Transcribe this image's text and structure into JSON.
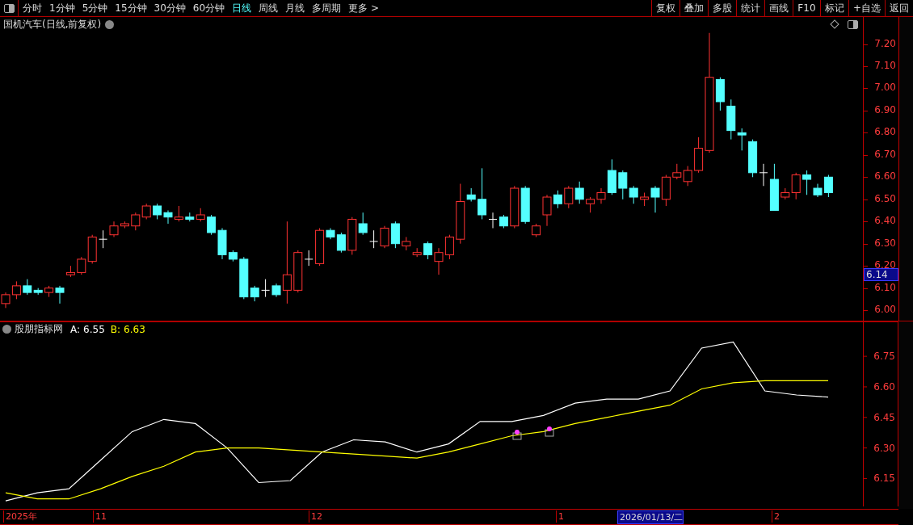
{
  "toolbar": {
    "periods": [
      {
        "label": "分时",
        "selected": false
      },
      {
        "label": "1分钟",
        "selected": false
      },
      {
        "label": "5分钟",
        "selected": false
      },
      {
        "label": "15分钟",
        "selected": false
      },
      {
        "label": "30分钟",
        "selected": false
      },
      {
        "label": "60分钟",
        "selected": false
      },
      {
        "label": "日线",
        "selected": true
      },
      {
        "label": "周线",
        "selected": false
      },
      {
        "label": "月线",
        "selected": false
      },
      {
        "label": "多周期",
        "selected": false
      }
    ],
    "more": "更多 >",
    "buttons": [
      "复权",
      "叠加",
      "多股",
      "统计",
      "画线",
      "F10",
      "标记",
      "+自选",
      "返回"
    ]
  },
  "price_chart": {
    "title": "国机汽车(日线,前复权)",
    "current_price": "6.14",
    "chart_data": {
      "type": "candlestick",
      "categories": [
        null,
        null,
        null,
        null,
        null,
        null,
        null,
        null,
        null,
        null,
        null,
        null,
        null,
        null,
        null,
        null,
        null,
        null,
        null,
        null,
        null,
        null,
        null,
        null,
        null,
        null,
        null,
        null,
        null,
        null,
        null,
        null,
        null,
        null,
        null,
        null,
        null,
        null,
        null,
        null,
        null,
        null,
        null,
        null,
        null,
        null,
        null,
        null,
        null,
        null,
        null,
        null,
        null,
        null,
        null,
        null,
        null,
        null,
        null,
        null,
        null,
        null,
        null,
        null,
        null,
        null,
        null,
        null,
        null,
        null,
        null,
        null,
        null,
        null,
        null,
        null,
        null
      ],
      "ylim": [
        5.953,
        7.322
      ],
      "yticks": [
        {
          "value": 7.2,
          "label": "7.20"
        },
        {
          "value": 7.1,
          "label": "7.10"
        },
        {
          "value": 7.0,
          "label": "7.00"
        },
        {
          "value": 6.9,
          "label": "6.90"
        },
        {
          "value": 6.8,
          "label": "6.80"
        },
        {
          "value": 6.7,
          "label": "6.70"
        },
        {
          "value": 6.6,
          "label": "6.60"
        },
        {
          "value": 6.5,
          "label": "6.50"
        },
        {
          "value": 6.4,
          "label": "6.40"
        },
        {
          "value": 6.3,
          "label": "6.30"
        },
        {
          "value": 6.2,
          "label": "6.20"
        },
        {
          "value": 6.1,
          "label": "6.10"
        },
        {
          "value": 6.0,
          "label": "6.00"
        }
      ],
      "ohlc": [
        [
          6.03,
          6.08,
          6.01,
          6.07
        ],
        [
          6.07,
          6.13,
          6.05,
          6.11
        ],
        [
          6.11,
          6.14,
          6.07,
          6.08
        ],
        [
          6.09,
          6.1,
          6.07,
          6.08
        ],
        [
          6.08,
          6.11,
          6.06,
          6.1
        ],
        [
          6.1,
          6.11,
          6.03,
          6.08
        ],
        [
          6.16,
          6.2,
          6.15,
          6.17
        ],
        [
          6.17,
          6.24,
          6.16,
          6.23
        ],
        [
          6.22,
          6.34,
          6.21,
          6.33
        ],
        [
          6.32,
          6.36,
          6.28,
          6.32
        ],
        [
          6.34,
          6.4,
          6.33,
          6.38
        ],
        [
          6.38,
          6.4,
          6.37,
          6.39
        ],
        [
          6.38,
          6.44,
          6.36,
          6.43
        ],
        [
          6.42,
          6.48,
          6.41,
          6.47
        ],
        [
          6.47,
          6.48,
          6.41,
          6.43
        ],
        [
          6.44,
          6.45,
          6.39,
          6.42
        ],
        [
          6.41,
          6.47,
          6.4,
          6.42
        ],
        [
          6.42,
          6.44,
          6.4,
          6.41
        ],
        [
          6.41,
          6.46,
          6.4,
          6.43
        ],
        [
          6.42,
          6.43,
          6.34,
          6.35
        ],
        [
          6.36,
          6.37,
          6.23,
          6.25
        ],
        [
          6.26,
          6.27,
          6.22,
          6.23
        ],
        [
          6.23,
          6.24,
          6.05,
          6.06
        ],
        [
          6.1,
          6.11,
          6.04,
          6.06
        ],
        [
          6.09,
          6.14,
          6.06,
          6.09
        ],
        [
          6.11,
          6.12,
          6.06,
          6.07
        ],
        [
          6.09,
          6.4,
          6.03,
          6.16
        ],
        [
          6.09,
          6.27,
          6.08,
          6.26
        ],
        [
          6.23,
          6.27,
          6.2,
          6.23
        ],
        [
          6.21,
          6.37,
          6.2,
          6.36
        ],
        [
          6.36,
          6.37,
          6.32,
          6.33
        ],
        [
          6.34,
          6.35,
          6.26,
          6.27
        ],
        [
          6.27,
          6.42,
          6.25,
          6.41
        ],
        [
          6.39,
          6.44,
          6.34,
          6.35
        ],
        [
          6.31,
          6.36,
          6.28,
          6.31
        ],
        [
          6.29,
          6.38,
          6.28,
          6.37
        ],
        [
          6.39,
          6.4,
          6.28,
          6.3
        ],
        [
          6.29,
          6.33,
          6.27,
          6.31
        ],
        [
          6.25,
          6.28,
          6.24,
          6.26
        ],
        [
          6.3,
          6.31,
          6.23,
          6.25
        ],
        [
          6.22,
          6.28,
          6.16,
          6.26
        ],
        [
          6.25,
          6.34,
          6.23,
          6.33
        ],
        [
          6.32,
          6.57,
          6.3,
          6.49
        ],
        [
          6.52,
          6.55,
          6.49,
          6.5
        ],
        [
          6.5,
          6.64,
          6.41,
          6.43
        ],
        [
          6.41,
          6.44,
          6.37,
          6.41
        ],
        [
          6.42,
          6.43,
          6.37,
          6.38
        ],
        [
          6.38,
          6.56,
          6.37,
          6.55
        ],
        [
          6.55,
          6.56,
          6.39,
          6.4
        ],
        [
          6.34,
          6.39,
          6.33,
          6.38
        ],
        [
          6.43,
          6.52,
          6.38,
          6.51
        ],
        [
          6.52,
          6.54,
          6.46,
          6.48
        ],
        [
          6.48,
          6.56,
          6.46,
          6.55
        ],
        [
          6.55,
          6.58,
          6.48,
          6.5
        ],
        [
          6.48,
          6.51,
          6.44,
          6.5
        ],
        [
          6.5,
          6.55,
          6.48,
          6.53
        ],
        [
          6.63,
          6.68,
          6.52,
          6.53
        ],
        [
          6.62,
          6.63,
          6.5,
          6.55
        ],
        [
          6.55,
          6.56,
          6.48,
          6.51
        ],
        [
          6.5,
          6.53,
          6.47,
          6.51
        ],
        [
          6.55,
          6.56,
          6.44,
          6.51
        ],
        [
          6.5,
          6.61,
          6.47,
          6.6
        ],
        [
          6.6,
          6.66,
          6.59,
          6.62
        ],
        [
          6.58,
          6.65,
          6.56,
          6.63
        ],
        [
          6.63,
          6.78,
          6.62,
          6.73
        ],
        [
          6.72,
          7.25,
          6.71,
          7.05
        ],
        [
          7.04,
          7.05,
          6.9,
          6.94
        ],
        [
          6.92,
          6.95,
          6.77,
          6.81
        ],
        [
          6.8,
          6.82,
          6.72,
          6.79
        ],
        [
          6.76,
          6.77,
          6.6,
          6.62
        ],
        [
          6.62,
          6.66,
          6.56,
          6.62
        ],
        [
          6.59,
          6.66,
          6.45,
          6.45
        ],
        [
          6.51,
          6.55,
          6.5,
          6.53
        ],
        [
          6.53,
          6.62,
          6.5,
          6.61
        ],
        [
          6.61,
          6.63,
          6.52,
          6.59
        ],
        [
          6.55,
          6.57,
          6.51,
          6.52
        ],
        [
          6.6,
          6.61,
          6.51,
          6.53
        ]
      ]
    }
  },
  "indicator": {
    "name": "股朋指标网",
    "legend": [
      {
        "value": "6.55"
      },
      {
        "value": "6.63"
      }
    ],
    "chart_data": {
      "type": "line",
      "categories": [
        null,
        null,
        null,
        null,
        null,
        null,
        null,
        null,
        null,
        null,
        null,
        null,
        null,
        null,
        null,
        null,
        null,
        null,
        null,
        null,
        null,
        null,
        null,
        null,
        null,
        null,
        null
      ],
      "ylim": [
        6.013,
        6.921
      ],
      "yticks": [
        {
          "value": 6.15,
          "label": "6.15"
        },
        {
          "value": 6.3,
          "label": "6.30"
        },
        {
          "value": 6.45,
          "label": "6.45"
        },
        {
          "value": 6.6,
          "label": "6.60"
        },
        {
          "value": 6.75,
          "label": "6.75"
        }
      ],
      "series": [
        {
          "name": "A:",
          "color": "#ffffff",
          "values": [
            6.04,
            6.08,
            6.1,
            6.24,
            6.38,
            6.44,
            6.42,
            6.3,
            6.13,
            6.14,
            6.28,
            6.34,
            6.33,
            6.28,
            6.32,
            6.43,
            6.43,
            6.46,
            6.52,
            6.54,
            6.54,
            6.58,
            6.79,
            6.82,
            6.58,
            6.56,
            6.55
          ]
        },
        {
          "name": "B:",
          "color": "#ffff00",
          "values": [
            6.08,
            6.05,
            6.05,
            6.1,
            6.16,
            6.21,
            6.28,
            6.3,
            6.3,
            6.29,
            6.28,
            6.27,
            6.26,
            6.25,
            6.28,
            6.32,
            6.36,
            6.38,
            6.42,
            6.45,
            6.48,
            6.51,
            6.59,
            6.62,
            6.63,
            6.63,
            6.63
          ]
        }
      ]
    }
  },
  "date_axis": [
    {
      "label": "2025年",
      "selected": false
    },
    {
      "label": "11",
      "selected": false
    },
    {
      "label": "12",
      "selected": false
    },
    {
      "label": "1",
      "selected": false
    },
    {
      "label": "2026/01/13/二",
      "selected": true
    },
    {
      "label": "2",
      "selected": false
    }
  ]
}
